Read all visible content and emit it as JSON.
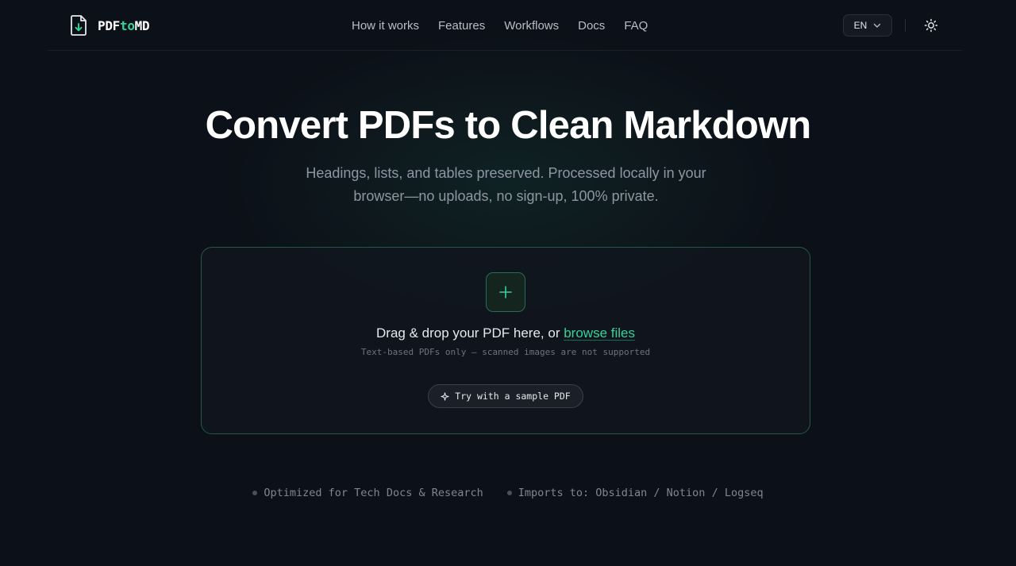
{
  "header": {
    "logo": {
      "prefix": "PDF",
      "accent": "to",
      "suffix": "MD",
      "icon": "file-download-icon"
    },
    "nav": [
      "How it works",
      "Features",
      "Workflows",
      "Docs",
      "FAQ"
    ],
    "language": "EN",
    "theme_icon": "sun-icon"
  },
  "hero": {
    "title": "Convert PDFs to Clean Markdown",
    "subtitle": "Headings, lists, and tables preserved. Processed locally in your browser—no uploads, no sign-up, 100% private."
  },
  "dropzone": {
    "icon": "plus-icon",
    "text_before": "Drag & drop your PDF here, or ",
    "browse_link": "browse files",
    "note": "Text-based PDFs only — scanned images are not supported",
    "sample_button": "Try with a sample PDF",
    "sample_icon": "sparkle-icon"
  },
  "badges": [
    "Optimized for Tech Docs & Research",
    "Imports to: Obsidian / Notion / Logseq"
  ],
  "colors": {
    "accent": "#34d399",
    "background": "#0c1018",
    "border_accent": "#1f5a45"
  }
}
